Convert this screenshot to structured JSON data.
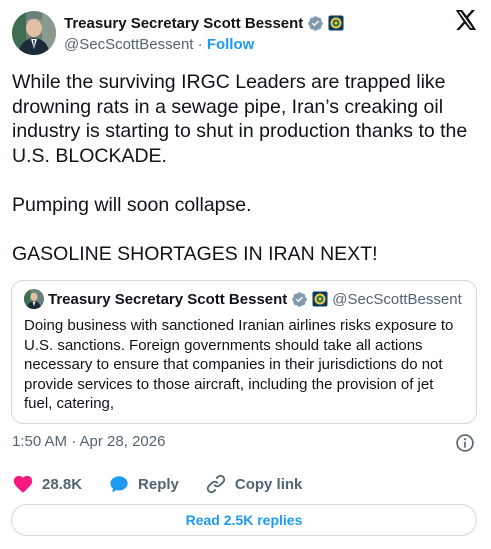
{
  "author": {
    "display_name": "Treasury Secretary Scott Bessent",
    "handle": "@SecScottBessent",
    "separator": " · ",
    "follow_label": "Follow",
    "verified_icon": "gray-verified-check-icon",
    "affiliation_icon": "treasury-seal-icon"
  },
  "platform_icon": "x-logo-icon",
  "tweet": {
    "text": "While the surviving IRGC Leaders are trapped like drowning rats in a sewage pipe, Iran’s creaking oil industry is starting to shut in production thanks to the U.S. BLOCKADE.\n\nPumping will soon collapse.\n\nGASOLINE SHORTAGES IN IRAN NEXT!"
  },
  "quoted_tweet": {
    "display_name": "Treasury Secretary Scott Bessent",
    "handle": "@SecScottBessent",
    "text": "Doing business with sanctioned Iranian airlines risks exposure to U.S. sanctions.  Foreign governments should take all actions necessary to ensure that companies in their jurisdictions do not provide services to those aircraft, including the provision of jet fuel, catering,"
  },
  "timestamp": "1:50 AM · Apr 28, 2026",
  "actions": {
    "likes": "28.8K",
    "reply_label": "Reply",
    "copy_link_label": "Copy link"
  },
  "read_replies_label": "Read 2.5K replies",
  "colors": {
    "accent": "#1d9bf0",
    "like": "#f91880",
    "secondary_text": "#536471",
    "border": "#cfd9de"
  }
}
